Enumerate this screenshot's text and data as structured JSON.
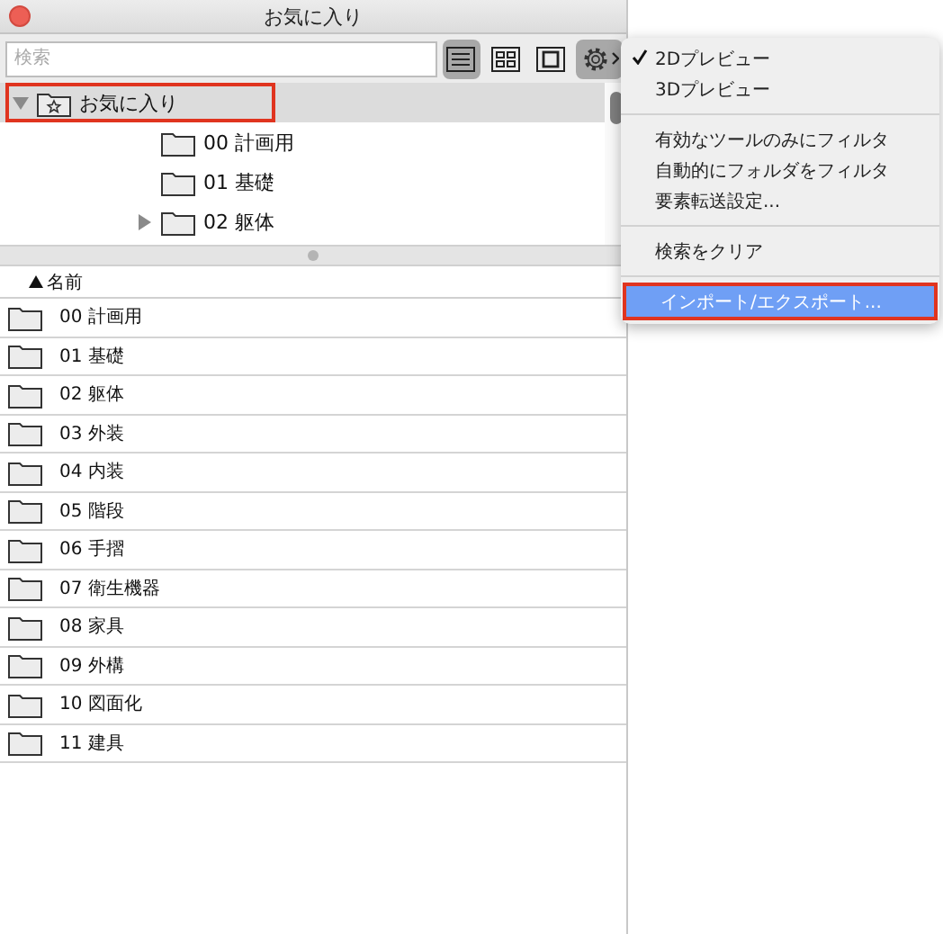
{
  "window": {
    "title": "お気に入り"
  },
  "search": {
    "placeholder": "検索"
  },
  "view_buttons": [
    {
      "kind": "list",
      "selected": true
    },
    {
      "kind": "grid",
      "selected": false
    },
    {
      "kind": "single",
      "selected": false
    },
    {
      "kind": "gear",
      "selected": true
    }
  ],
  "tree": {
    "label": "お気に入り",
    "expanded": true,
    "selected": true,
    "outlined": true,
    "children": [
      {
        "label": "00 計画用",
        "expandable": false
      },
      {
        "label": "01 基礎",
        "expandable": false
      },
      {
        "label": "02 躯体",
        "expandable": true,
        "expanded": false
      }
    ]
  },
  "list": {
    "sort_column": "名前",
    "rows": [
      "00 計画用",
      "01 基礎",
      "02 躯体",
      "03 外装",
      "04 内装",
      "05 階段",
      "06 手摺",
      "07 衛生機器",
      "08 家具",
      "09 外構",
      "10 図面化",
      "11 建具"
    ]
  },
  "menu": [
    {
      "kind": "item",
      "label": "2Dプレビュー",
      "checked": true,
      "highlighted": false,
      "outlined": false
    },
    {
      "kind": "item",
      "label": "3Dプレビュー",
      "checked": false,
      "highlighted": false,
      "outlined": false
    },
    {
      "kind": "separator"
    },
    {
      "kind": "item",
      "label": "有効なツールのみにフィルタ",
      "checked": false,
      "highlighted": false,
      "outlined": false
    },
    {
      "kind": "item",
      "label": "自動的にフォルダをフィルタ",
      "checked": false,
      "highlighted": false,
      "outlined": false
    },
    {
      "kind": "item",
      "label": "要素転送設定...",
      "checked": false,
      "highlighted": false,
      "outlined": false
    },
    {
      "kind": "separator"
    },
    {
      "kind": "item",
      "label": "検索をクリア",
      "checked": false,
      "highlighted": false,
      "outlined": false
    },
    {
      "kind": "separator"
    },
    {
      "kind": "item",
      "label": "インポート/エクスポート...",
      "checked": false,
      "highlighted": true,
      "outlined": true
    }
  ]
}
